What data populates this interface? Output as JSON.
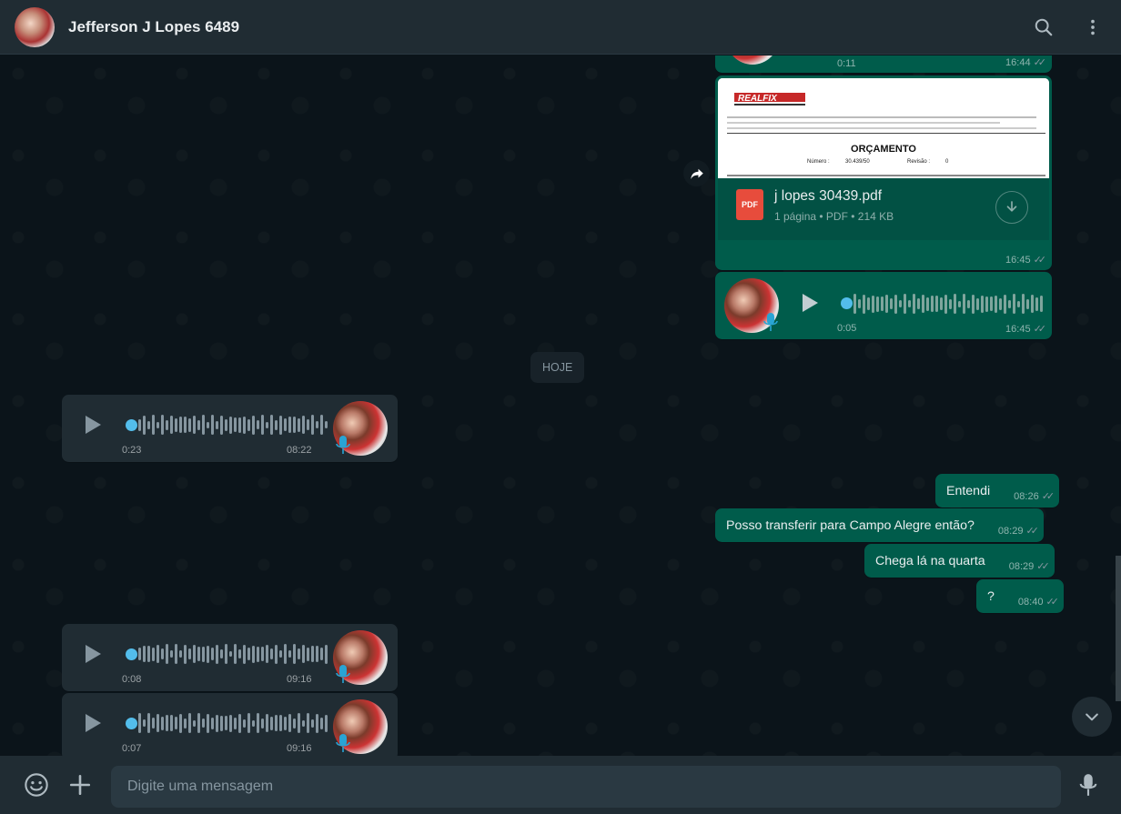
{
  "header": {
    "contact_name": "Jefferson J Lopes 6489",
    "icons": [
      "search-icon",
      "menu-icon"
    ]
  },
  "colors": {
    "outgoing_bubble": "#005c4b",
    "incoming_bubble": "#202c33",
    "accent": "#53bdeb",
    "background": "#0b141a"
  },
  "messages": {
    "m0_voice_out": {
      "duration": "0:11",
      "time": "16:44"
    },
    "m1_document": {
      "preview_brand": "REALFIX",
      "preview_title": "ORÇAMENTO",
      "preview_numero_label": "Número :",
      "preview_numero": "30.439/50",
      "preview_revisao_label": "Revisão :",
      "preview_revisao": "0",
      "file_name": "j lopes 30439.pdf",
      "file_type_badge": "PDF",
      "pages": "1 página",
      "type": "PDF",
      "size": "214 KB",
      "time": "16:45"
    },
    "m2_voice_out": {
      "duration": "0:05",
      "time": "16:45"
    },
    "date_divider": "HOJE",
    "m3_voice_in": {
      "duration": "0:23",
      "time": "08:22"
    },
    "m4_text_out": {
      "text": "Entendi",
      "time": "08:26"
    },
    "m5_text_out": {
      "text": "Posso transferir para Campo Alegre então?",
      "time": "08:29"
    },
    "m6_text_out": {
      "text": "Chega lá na quarta",
      "time": "08:29"
    },
    "m7_text_out": {
      "text": "?",
      "time": "08:40"
    },
    "m8_voice_in": {
      "duration": "0:08",
      "time": "09:16"
    },
    "m9_voice_in": {
      "duration": "0:07",
      "time": "09:16"
    }
  },
  "footer": {
    "input_placeholder": "Digite uma mensagem",
    "input_value": "",
    "icons": [
      "emoji-icon",
      "attach-plus-icon",
      "microphone-icon"
    ]
  }
}
